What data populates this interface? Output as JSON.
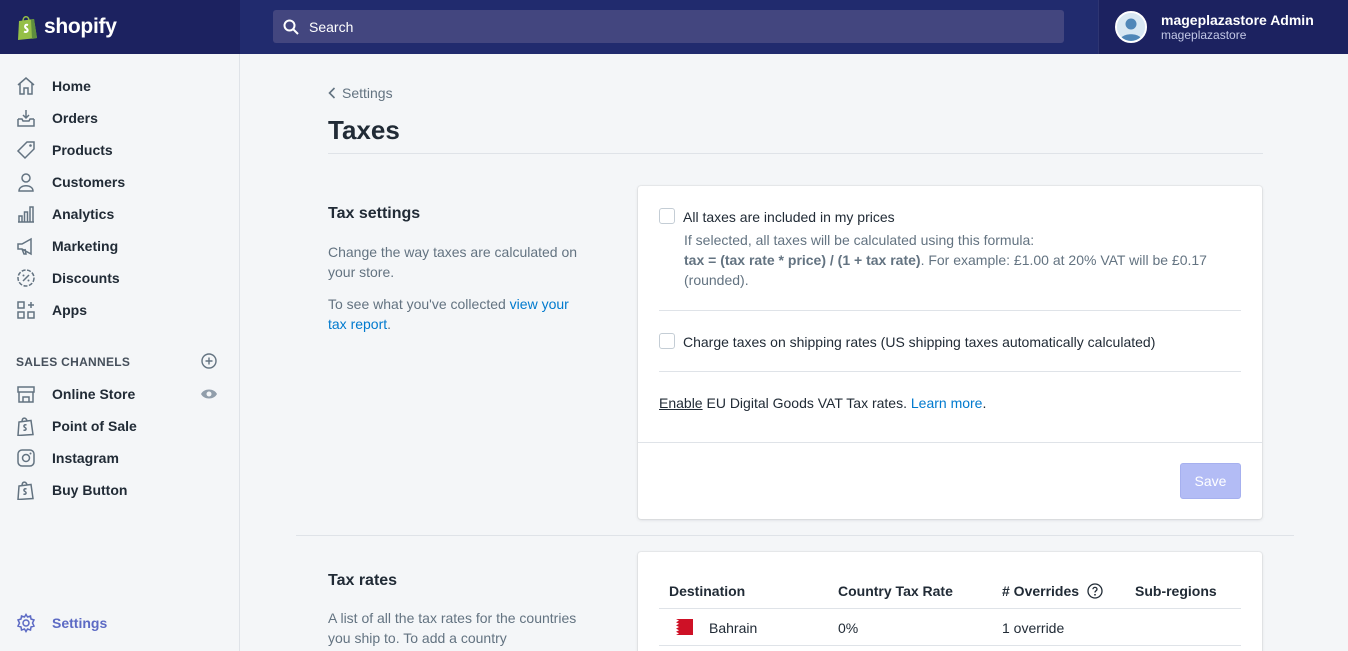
{
  "brand": {
    "name": "shopify"
  },
  "search": {
    "placeholder": "Search"
  },
  "account": {
    "name": "mageplazastore Admin",
    "store": "mageplazastore"
  },
  "sidebar": {
    "items": [
      {
        "label": "Home",
        "icon": "home-icon"
      },
      {
        "label": "Orders",
        "icon": "orders-icon"
      },
      {
        "label": "Products",
        "icon": "tag-icon"
      },
      {
        "label": "Customers",
        "icon": "person-icon"
      },
      {
        "label": "Analytics",
        "icon": "bar-chart-icon"
      },
      {
        "label": "Marketing",
        "icon": "megaphone-icon"
      },
      {
        "label": "Discounts",
        "icon": "discount-icon"
      },
      {
        "label": "Apps",
        "icon": "apps-icon"
      }
    ],
    "sales_channels_label": "SALES CHANNELS",
    "channels": [
      {
        "label": "Online Store",
        "icon": "store-icon"
      },
      {
        "label": "Point of Sale",
        "icon": "shopify-bag-icon"
      },
      {
        "label": "Instagram",
        "icon": "instagram-icon"
      },
      {
        "label": "Buy Button",
        "icon": "shopify-bag-icon"
      }
    ],
    "settings_label": "Settings"
  },
  "page": {
    "breadcrumb": "Settings",
    "title": "Taxes"
  },
  "tax_settings": {
    "title": "Tax settings",
    "desc1": "Change the way taxes are calculated on your store.",
    "desc2_prefix": "To see what you've collected ",
    "desc2_link": "view your tax report",
    "desc2_suffix": ".",
    "opt1_label": "All taxes are included in my prices",
    "opt1_help1": "If selected, all taxes will be calculated using this formula:",
    "opt1_formula": "tax = (tax rate * price) / (1 + tax rate)",
    "opt1_help2": ". For example: £1.00 at 20% VAT will be £0.17 (rounded).",
    "opt2_label": "Charge taxes on shipping rates (US shipping taxes automatically calculated)",
    "eu_enable": "Enable",
    "eu_text": " EU Digital Goods VAT Tax rates. ",
    "eu_learn": "Learn more",
    "eu_end": ".",
    "save_label": "Save"
  },
  "tax_rates": {
    "title": "Tax rates",
    "desc": "A list of all the tax rates for the countries you ship to. To add a country",
    "columns": [
      "Destination",
      "Country Tax Rate",
      "# Overrides",
      "Sub-regions"
    ],
    "rows": [
      {
        "destination": "Bahrain",
        "rate": "0%",
        "overrides": "1 override",
        "subregions": ""
      }
    ]
  },
  "colors": {
    "topbar": "#212b6e",
    "accent": "#5c6ac4",
    "link": "#007ace",
    "save_disabled": "#b3bcf5",
    "flag": "#ce1126"
  }
}
